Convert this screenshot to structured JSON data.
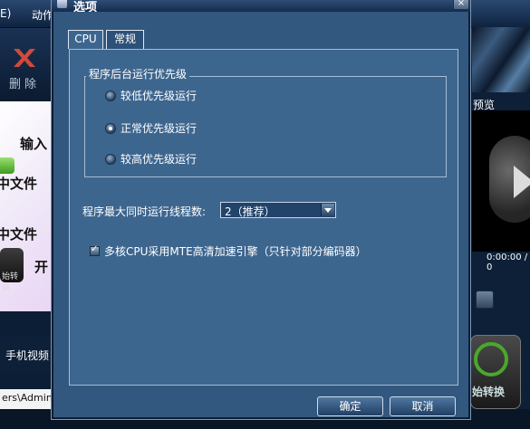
{
  "background_app": {
    "menu": [
      {
        "label": "E)"
      },
      {
        "label": "动作"
      }
    ],
    "toolbar": {
      "delete_label": "删除"
    },
    "left_panel": {
      "line1": "输入",
      "line2": "中文件",
      "line3": "中文件",
      "line4": "开",
      "convert_icon_label": "始转换"
    },
    "category_label": "手机视频",
    "path_text": "ers\\Adminis",
    "preview": {
      "label": "预览",
      "time": "0:00:00 / 0"
    },
    "convert_button_label": "始转换"
  },
  "dialog": {
    "title": "选项",
    "close_glyph": "×",
    "tabs": [
      {
        "label": "CPU",
        "active": true
      },
      {
        "label": "常规",
        "active": false
      }
    ],
    "priority_group": {
      "title": "程序后台运行优先级",
      "options": [
        {
          "label": "较低优先级运行",
          "selected": false
        },
        {
          "label": "正常优先级运行",
          "selected": true
        },
        {
          "label": "较高优先级运行",
          "selected": false
        }
      ]
    },
    "thread_count": {
      "label": "程序最大同时运行线程数:",
      "value": "2（推荐）"
    },
    "mte_option": {
      "label": "多核CPU采用MTE高清加速引擎（只针对部分编码器）",
      "checked": true
    },
    "ok_label": "确定",
    "cancel_label": "取消"
  },
  "colors": {
    "dialog_bg": "#33587f",
    "panel_bg": "#3d668f",
    "border": "#a6bcd4",
    "app_bg": "#0b1e35"
  }
}
